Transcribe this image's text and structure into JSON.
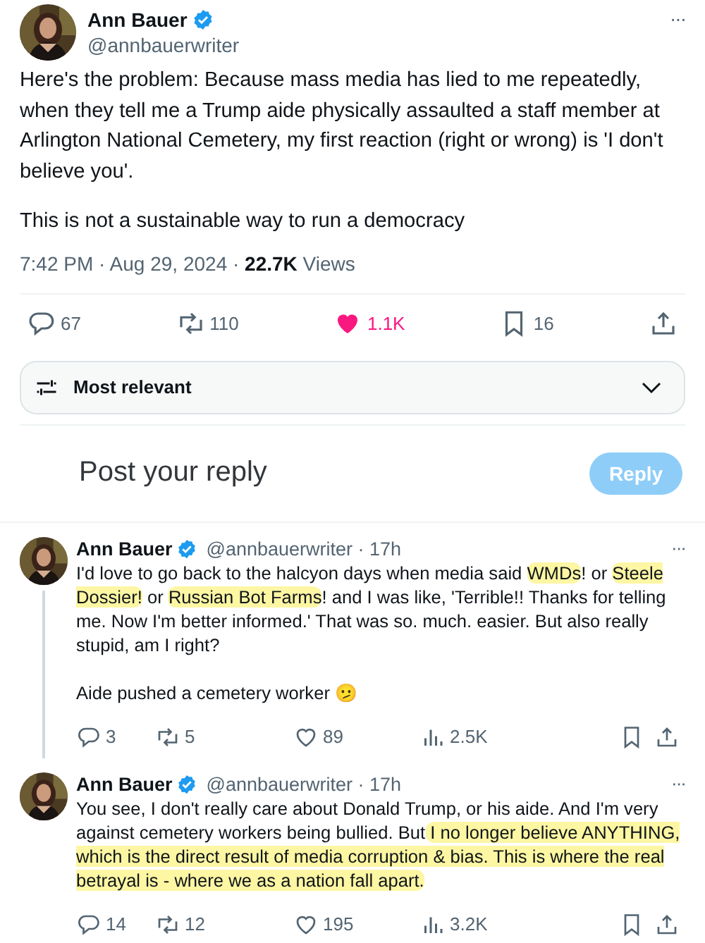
{
  "post": {
    "author": {
      "name": "Ann Bauer",
      "verified": true,
      "handle": "@annbauerwriter"
    },
    "more": "···",
    "paragraphs": [
      "Here's the problem: Because mass media has lied to me repeatedly, when they tell me a Trump aide physically assaulted a staff member at Arlington National Cemetery, my first reaction (right or wrong) is 'I don't believe you'.",
      "This is not a sustainable way to run a democracy"
    ],
    "meta": "7:42 PM · Aug 29, 2024 · **22.7K** Views",
    "actions": [
      {
        "kind": "reply",
        "count": "67",
        "active": false
      },
      {
        "kind": "repost",
        "count": "110",
        "active": false
      },
      {
        "kind": "like",
        "count": "1.1K",
        "active": true
      },
      {
        "kind": "bookmark",
        "count": "16",
        "active": false
      },
      {
        "kind": "share",
        "active": false
      }
    ]
  },
  "sort": {
    "label": "Most relevant"
  },
  "composer": {
    "placeholder": "Post your reply",
    "button": "Reply",
    "disabled": true
  },
  "replies": [
    {
      "author": {
        "name": "Ann Bauer",
        "verified": true
      },
      "byline": "@annbauerwriter · 17h",
      "more": "···",
      "thread_line": true,
      "paragraphs": [
        [
          {
            "text": "I'd love to go back to the halcyon days when media said ",
            "highlighted": false
          },
          {
            "text": "WMDs",
            "highlighted": true
          },
          {
            "text": "! or ",
            "highlighted": false
          },
          {
            "text": "Steele Dossier!",
            "highlighted": true
          },
          {
            "text": " or ",
            "highlighted": false
          },
          {
            "text": "Russian Bot Farms",
            "highlighted": true
          },
          {
            "text": "! and I was like, 'Terrible!! Thanks for telling me. Now I'm better informed.' That was so. much. easier. But also really stupid, am I right?",
            "highlighted": false
          }
        ],
        [
          {
            "text": "Aide pushed a cemetery worker 🫤",
            "highlighted": false
          }
        ]
      ],
      "actions": [
        {
          "kind": "reply",
          "count": "3",
          "active": false
        },
        {
          "kind": "repost",
          "count": "5",
          "active": false
        },
        {
          "kind": "like",
          "count": "89",
          "active": false
        },
        {
          "kind": "views",
          "count": "2.5K",
          "active": false
        },
        {
          "kind": "bookmark",
          "active": false
        },
        {
          "kind": "share",
          "active": false
        }
      ]
    },
    {
      "author": {
        "name": "Ann Bauer",
        "verified": true
      },
      "byline": "@annbauerwriter · 17h",
      "more": "···",
      "thread_line": false,
      "paragraphs": [
        [
          {
            "text": "You see, I don't really care about Donald Trump, or his aide. And I'm very against cemetery workers being bullied. But",
            "highlighted": false
          },
          {
            "text": " I no longer believe ANYTHING, which is the direct result of media corruption & bias. This is where the real betrayal is - where we as a nation fall apart.",
            "highlighted": true
          }
        ]
      ],
      "actions": [
        {
          "kind": "reply",
          "count": "14",
          "active": false
        },
        {
          "kind": "repost",
          "count": "12",
          "active": false
        },
        {
          "kind": "like",
          "count": "195",
          "active": false
        },
        {
          "kind": "views",
          "count": "3.2K",
          "active": false
        },
        {
          "kind": "bookmark",
          "active": false
        },
        {
          "kind": "share",
          "active": false
        }
      ]
    }
  ]
}
